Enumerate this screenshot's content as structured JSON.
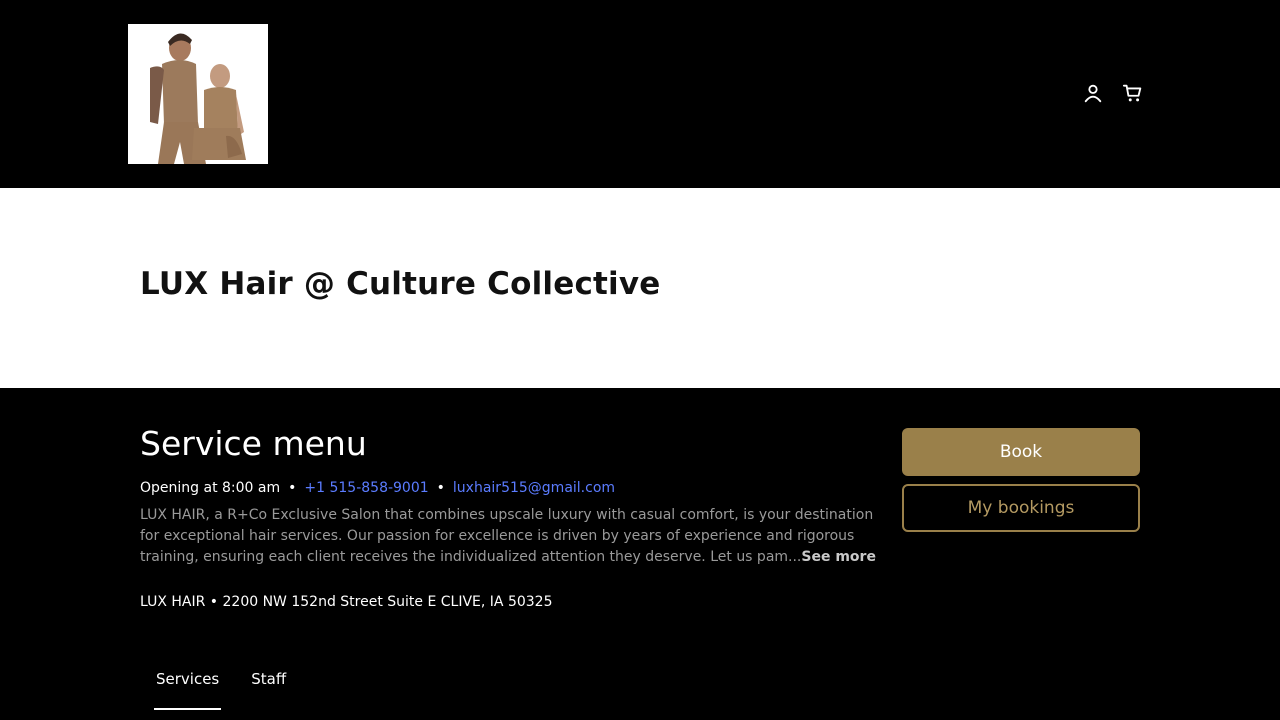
{
  "header": {
    "logo_alt": "LUX Hair logo",
    "account_icon": "user-icon",
    "cart_icon": "cart-icon"
  },
  "hero": {
    "title": "LUX Hair @ Culture Collective"
  },
  "menu": {
    "title": "Service menu",
    "opening": "Opening at 8:00 am",
    "separator": "•",
    "phone": "+1 515-858-9001",
    "email": "luxhair515@gmail.com",
    "description": "LUX HAIR, a R+Co Exclusive Salon that combines upscale luxury with casual comfort, is your destination for exceptional hair services. Our passion for excellence is driven by years of experience and rigorous training, ensuring each client receives the individualized attention they deserve. Let us pam...",
    "see_more": "See more",
    "address": "LUX HAIR • 2200 NW 152nd Street Suite E CLIVE, IA 50325"
  },
  "actions": {
    "book_label": "Book",
    "bookings_label": "My bookings"
  },
  "tabs": [
    {
      "label": "Services",
      "active": true
    },
    {
      "label": "Staff",
      "active": false
    }
  ],
  "colors": {
    "accent": "#9a804a",
    "background": "#000000",
    "link": "#5b7cff"
  }
}
